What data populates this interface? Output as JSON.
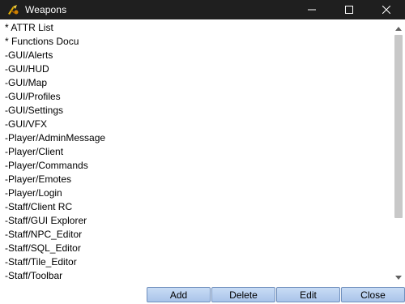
{
  "window": {
    "title": "Weapons",
    "icon": "weapon-app-icon"
  },
  "controls": {
    "minimize": "minimize-icon",
    "maximize": "maximize-icon",
    "close": "close-icon"
  },
  "list": {
    "items": [
      "* ATTR List",
      "* Functions Docu",
      "-GUI/Alerts",
      "-GUI/HUD",
      "-GUI/Map",
      "-GUI/Profiles",
      "-GUI/Settings",
      "-GUI/VFX",
      "-Player/AdminMessage",
      "-Player/Client",
      "-Player/Commands",
      "-Player/Emotes",
      "-Player/Login",
      "-Staff/Client RC",
      "-Staff/GUI Explorer",
      "-Staff/NPC_Editor",
      "-Staff/SQL_Editor",
      "-Staff/Tile_Editor",
      "-Staff/Toolbar"
    ]
  },
  "buttons": {
    "add": "Add",
    "delete": "Delete",
    "edit": "Edit",
    "close": "Close"
  },
  "colors": {
    "titlebar": "#1f1f1f",
    "button_fill": "#b9d1f0",
    "button_border": "#6f8fbd",
    "scroll_thumb": "#c8c8c8"
  }
}
